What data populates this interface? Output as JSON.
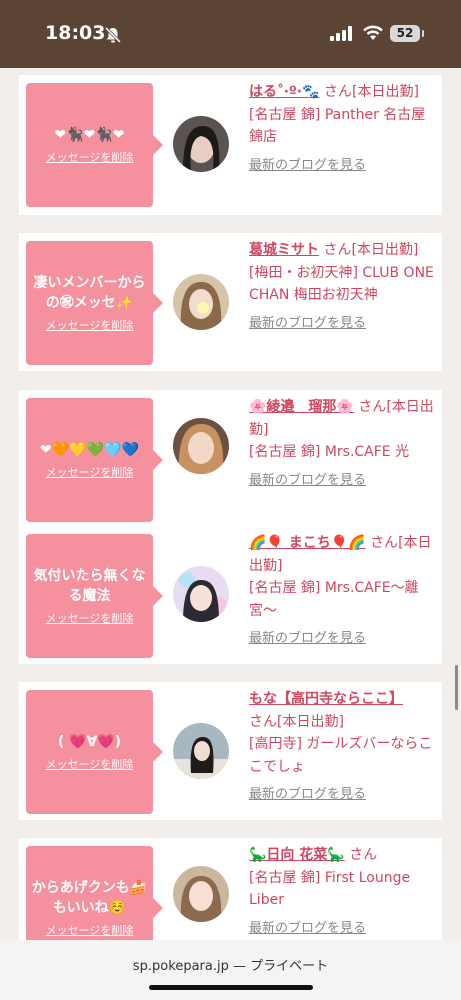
{
  "status": {
    "time": "18:03",
    "battery": "52"
  },
  "cards": [
    {
      "message": "❤🐈‍⬛❤🐈‍⬛❤",
      "delete": "メッセージを削除",
      "name": "はる˚‧º·🐾",
      "san": "さん",
      "info": "[本日出勤]\n[名古屋 錦] Panther 名古屋錦店",
      "blog": "最新のブログを見る"
    },
    {
      "message": "凄いメンバーからの㊗メッセ✨",
      "delete": "メッセージを削除",
      "name": "葛城ミサト",
      "san": "さん",
      "info": "[本日出勤]\n[梅田・お初天神] CLUB ONE CHAN 梅田お初天神",
      "blog": "最新のブログを見る"
    },
    {
      "message": "❤🧡💛💚🩵💙",
      "delete": "メッセージを削除",
      "name": "🌸綾邉　瑠那🌸",
      "san": "さん",
      "info": "[本日出勤]\n[名古屋 錦] Mrs.CAFE 光",
      "blog": "最新のブログを見る"
    },
    {
      "message": "気付いたら無くなる魔法",
      "delete": "メッセージを削除",
      "name": "🌈🎈 まこち🎈🌈",
      "san": "さん",
      "info": "[本日出勤]\n[名古屋 錦] Mrs.CAFE〜離宮〜",
      "blog": "最新のブログを見る"
    },
    {
      "message": "( 💗∀💗)",
      "delete": "メッセージを削除",
      "name": "もな【高円寺ならここ】",
      "san": "さん",
      "info": "[本日出勤]\n[高円寺] ガールズバーならここでしょ",
      "blog": "最新のブログを見る"
    },
    {
      "message": "からあげクンも🍰もいいね☺️",
      "delete": "メッセージを削除",
      "name": "🦕日向 花菜🦕",
      "san": "さん",
      "info": "[名古屋 錦] First Lounge Liber",
      "blog": "最新のブログを見る"
    }
  ],
  "browser": {
    "url": "sp.pokepara.jp — プライベート"
  }
}
